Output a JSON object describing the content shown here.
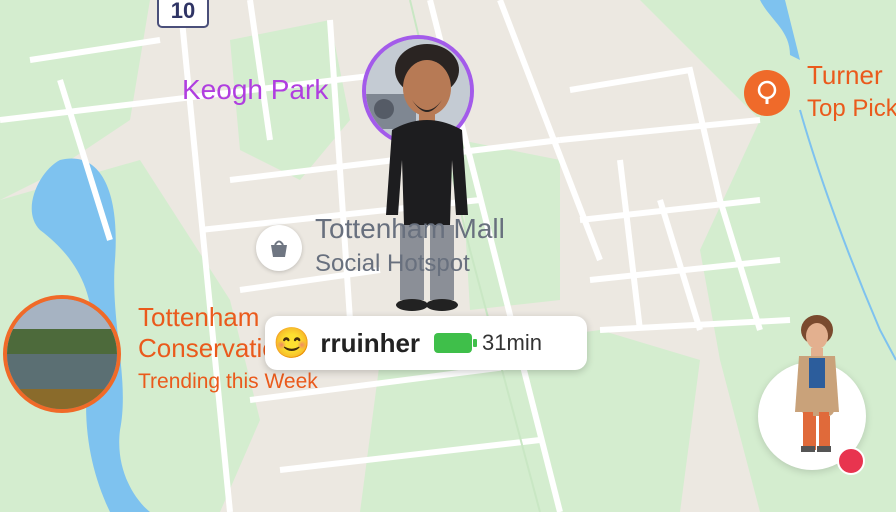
{
  "map": {
    "route_shield": "10",
    "park": {
      "label": "Keogh Park",
      "color": "#b03ee0"
    },
    "mall": {
      "name": "Tottenham Mall",
      "subtitle": "Social Hotspot",
      "icon": "shopping-bag-icon"
    },
    "conservation": {
      "title_line1": "Tottenham",
      "title_line2": "Conservation",
      "subtitle": "Trending this Week",
      "color": "#ea5a1c"
    },
    "turner": {
      "title": "Turner",
      "subtitle": "Top Pick",
      "icon": "tree-icon"
    }
  },
  "friend": {
    "emoji": "😊",
    "username": "rruinher",
    "battery_level": 0.8,
    "last_seen": "31min"
  },
  "colors": {
    "water": "#7ec2ef",
    "park_green": "#d4edcf",
    "road": "#ffffff",
    "accent_orange": "#ef6a2a"
  }
}
